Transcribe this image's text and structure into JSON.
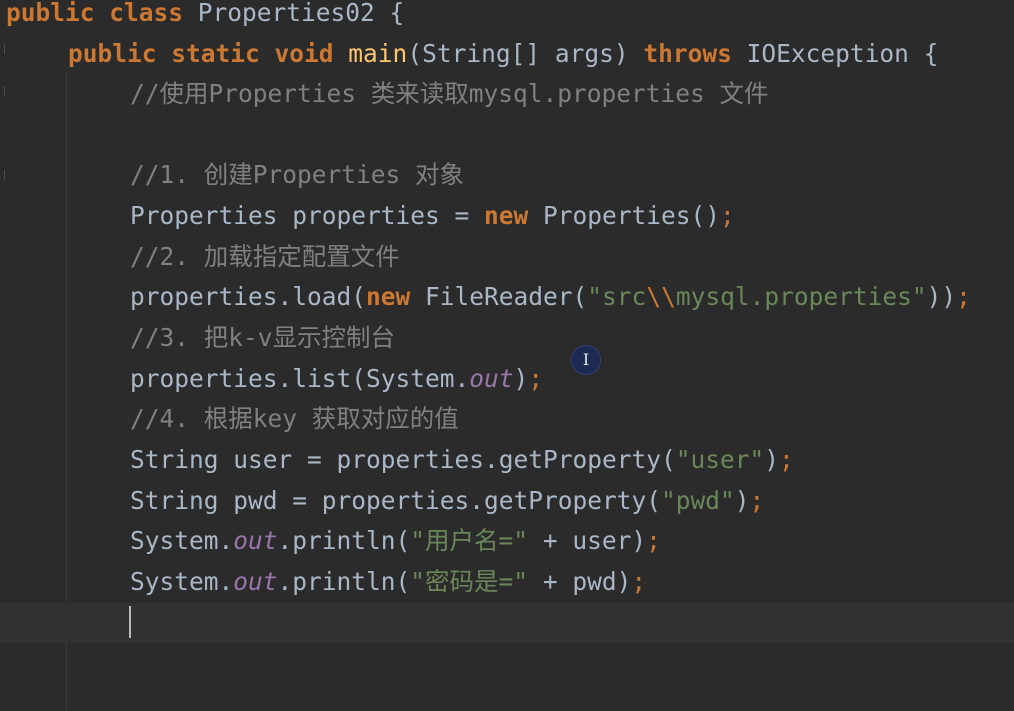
{
  "editor": {
    "theme": "darcula",
    "colors": {
      "background": "#2b2b2b",
      "keyword": "#cc7832",
      "method": "#ffc66d",
      "string": "#6a8759",
      "static_field": "#9876aa",
      "comment": "#808080",
      "text": "#a9b7c6"
    },
    "cursor_icon": "text-cursor-icon",
    "caret_line": 16,
    "lines": [
      {
        "segs": [
          [
            "kw",
            "public "
          ],
          [
            "kw",
            "class "
          ],
          [
            "plain",
            "Properties02 {"
          ]
        ]
      },
      {
        "segs": [
          [
            "kw",
            "public "
          ],
          [
            "kw",
            "static "
          ],
          [
            "kw",
            "void "
          ],
          [
            "fn",
            "main"
          ],
          [
            "plain",
            "(String[] args) "
          ],
          [
            "kw",
            "throws "
          ],
          [
            "plain",
            "IOException {"
          ]
        ]
      },
      {
        "segs": [
          [
            "cm",
            "//使用Properties 类来读取mysql.properties 文件"
          ]
        ]
      },
      {
        "segs": []
      },
      {
        "segs": [
          [
            "cm",
            "//1. 创建Properties 对象"
          ]
        ]
      },
      {
        "segs": [
          [
            "plain",
            "Properties properties = "
          ],
          [
            "kw",
            "new "
          ],
          [
            "plain",
            "Properties()"
          ],
          [
            "semi",
            ";"
          ]
        ]
      },
      {
        "segs": [
          [
            "cm",
            "//2. 加载指定配置文件"
          ]
        ]
      },
      {
        "segs": [
          [
            "plain",
            "properties.load("
          ],
          [
            "kw",
            "new "
          ],
          [
            "plain",
            "FileReader("
          ],
          [
            "str",
            "\"src"
          ],
          [
            "esc",
            "\\\\"
          ],
          [
            "str",
            "mysql.properties\""
          ],
          [
            "plain",
            "))"
          ],
          [
            "semi",
            ";"
          ]
        ]
      },
      {
        "segs": [
          [
            "cm",
            "//3. 把k-v显示控制台"
          ]
        ]
      },
      {
        "segs": [
          [
            "plain",
            "properties.list(System."
          ],
          [
            "field",
            "out"
          ],
          [
            "plain",
            ")"
          ],
          [
            "semi",
            ";"
          ]
        ]
      },
      {
        "segs": [
          [
            "cm",
            "//4. 根据key 获取对应的值"
          ]
        ]
      },
      {
        "segs": [
          [
            "plain",
            "String user = properties.getProperty("
          ],
          [
            "str",
            "\"user\""
          ],
          [
            "plain",
            ")"
          ],
          [
            "semi",
            ";"
          ]
        ]
      },
      {
        "segs": [
          [
            "plain",
            "String pwd = properties.getProperty("
          ],
          [
            "str",
            "\"pwd\""
          ],
          [
            "plain",
            ")"
          ],
          [
            "semi",
            ";"
          ]
        ]
      },
      {
        "segs": [
          [
            "plain",
            "System."
          ],
          [
            "field",
            "out"
          ],
          [
            "plain",
            ".println("
          ],
          [
            "str",
            "\"用户名=\""
          ],
          [
            "plain",
            " + user)"
          ],
          [
            "semi",
            ";"
          ]
        ]
      },
      {
        "segs": [
          [
            "plain",
            "System."
          ],
          [
            "field",
            "out"
          ],
          [
            "plain",
            ".println("
          ],
          [
            "str",
            "\"密码是=\""
          ],
          [
            "plain",
            " + pwd)"
          ],
          [
            "semi",
            ";"
          ]
        ]
      },
      {
        "segs": []
      }
    ]
  }
}
